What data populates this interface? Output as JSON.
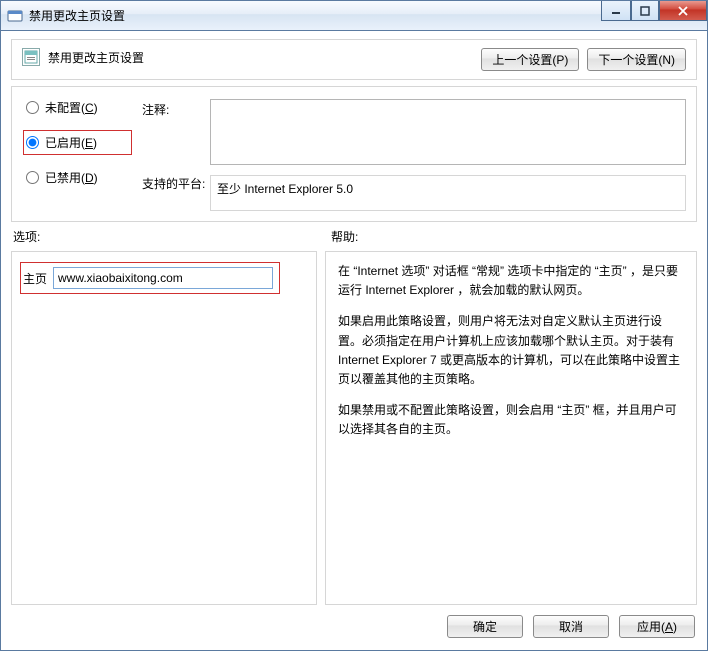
{
  "window": {
    "title": "禁用更改主页设置"
  },
  "header": {
    "title": "禁用更改主页设置",
    "prev_btn": "上一个设置(P)",
    "next_btn": "下一个设置(N)"
  },
  "config": {
    "radio_not_configured": "未配置(C)",
    "radio_enabled": "已启用(E)",
    "radio_disabled": "已禁用(D)",
    "selected": "enabled",
    "comment_label": "注释:",
    "comment_value": "",
    "platform_label": "支持的平台:",
    "platform_value": "至少 Internet Explorer 5.0"
  },
  "sections": {
    "options_label": "选项:",
    "help_label": "帮助:"
  },
  "options": {
    "homepage_label": "主页",
    "homepage_value": "www.xiaobaixitong.com"
  },
  "help": {
    "p1": "在 “Internet 选项” 对话框 “常规” 选项卡中指定的 “主页” ，是只要运行 Internet Explorer ，就会加载的默认网页。",
    "p2": "如果启用此策略设置，则用户将无法对自定义默认主页进行设置。必须指定在用户计算机上应该加载哪个默认主页。对于装有 Internet Explorer 7 或更高版本的计算机，可以在此策略中设置主页以覆盖其他的主页策略。",
    "p3": "如果禁用或不配置此策略设置，则会启用 “主页” 框，并且用户可以选择其各自的主页。"
  },
  "footer": {
    "ok": "确定",
    "cancel": "取消",
    "apply": "应用(A)"
  }
}
